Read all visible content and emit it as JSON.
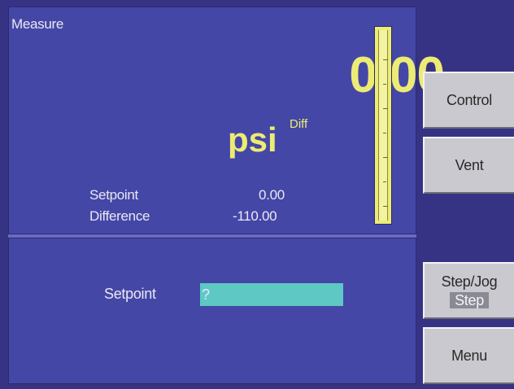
{
  "measure": {
    "title": "Measure",
    "value": "0.00",
    "unit": "psi",
    "mode": "Diff",
    "setpoint_label": "Setpoint",
    "setpoint_value": "0.00",
    "difference_label": "Difference",
    "difference_value": "-110.00"
  },
  "entry": {
    "setpoint_label": "Setpoint",
    "setpoint_value": "?"
  },
  "softkeys": {
    "control": "Control",
    "vent": "Vent",
    "stepjog": "Step/Jog",
    "stepjog_mode": "Step",
    "menu": "Menu"
  },
  "colors": {
    "panel": "#4547a6",
    "background": "#373384",
    "value_text": "#ecec74",
    "input_bg": "#5ec8c4",
    "softkey": "#c9c9cf"
  }
}
